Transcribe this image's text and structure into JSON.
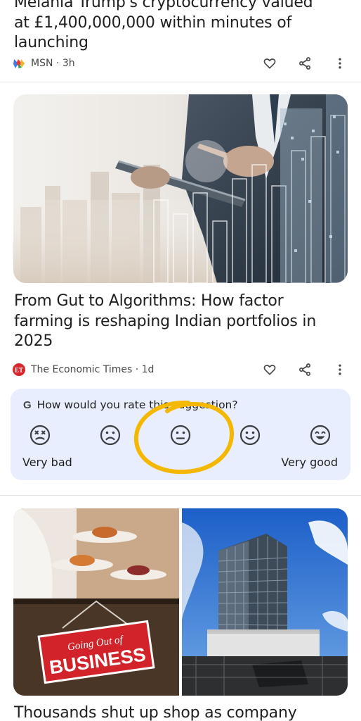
{
  "article1": {
    "title_line0": "Melania Trump's cryptocurrency valued",
    "title_line1": "at £1,400,000,000 within minutes of",
    "title_line2": "launching",
    "source": "MSN",
    "age": "3h"
  },
  "article2": {
    "title_line1": "From Gut to Algorithms: How factor",
    "title_line2": "farming is reshaping Indian portfolios in",
    "title_line3": "2025",
    "source": "The Economic Times",
    "source_logo_text": "ET",
    "age": "1d",
    "image_icon": "businessman-tablet-city-chart-image"
  },
  "rating": {
    "logo": "G",
    "question": "How would you rate this suggestion?",
    "low_label": "Very bad",
    "high_label": "Very good",
    "faces": [
      "very-bad-face-icon",
      "bad-face-icon",
      "neutral-face-icon",
      "good-face-icon",
      "very-good-face-icon"
    ],
    "highlight_color": "#f5b800"
  },
  "article3": {
    "sign_line1": "Going Out of",
    "sign_line2": "BUSINESS",
    "title_line1": "Thousands shut up shop as company",
    "left_image_icon": "restaurant-closing-sign-image",
    "right_image_icon": "high-rise-construction-image"
  },
  "colors": {
    "rating_bg": "#e8eefd",
    "text_primary": "#1f1f1f",
    "text_secondary": "#444746",
    "et_red": "#d9262c"
  }
}
